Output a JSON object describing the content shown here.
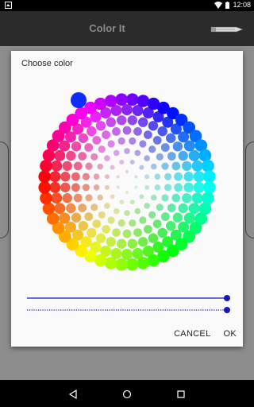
{
  "status_bar": {
    "time": "12:08"
  },
  "app_bar": {
    "title": "Color It"
  },
  "dialog": {
    "title": "Choose color",
    "cancel_label": "CANCEL",
    "ok_label": "OK",
    "selected_color": "#0d2cff"
  },
  "sliders": [
    {
      "name": "lightness",
      "value": 1.0,
      "color": "#1a18b8"
    },
    {
      "name": "alpha",
      "value": 1.0,
      "color": "#1a18b8"
    }
  ],
  "icons": [
    "notification-icon",
    "wifi-icon",
    "battery-icon",
    "pencil-tool-icon",
    "back-icon",
    "home-icon",
    "recents-icon"
  ]
}
